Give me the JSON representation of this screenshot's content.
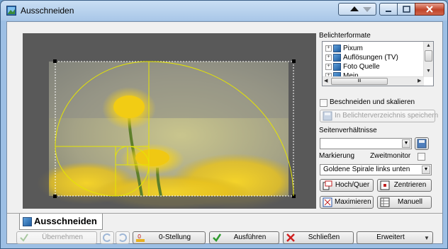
{
  "window": {
    "title": "Ausschneiden"
  },
  "panel": {
    "formats_label": "Belichterformate",
    "tree_items": [
      "Pixum",
      "Auflösungen (TV)",
      "Foto Quelle",
      "Mein"
    ],
    "hscroll_glyph": "III",
    "crop_scale_label": "Beschneiden und skalieren",
    "save_button": "In Belichterverzeichnis speichern",
    "aspect_label": "Seitenverhältnisse",
    "aspect_value": "",
    "marking_label": "Markierung",
    "second_monitor_label": "Zweitmonitor",
    "marking_value": "Goldene Spirale links unten",
    "portrait_button": "Hoch/Quer",
    "center_button": "Zentrieren",
    "maximize_button": "Maximieren",
    "manual_button": "Manuell"
  },
  "tab": {
    "label": "Ausschneiden"
  },
  "bottom": {
    "apply_button": "Übernehmen",
    "zero_button": "0-Stellung",
    "execute_button": "Ausführen",
    "close_button": "Schließen",
    "extended_button": "Erweitert"
  },
  "colors": {
    "accent": "#3c5f86",
    "golden_overlay": "#e6e600"
  }
}
